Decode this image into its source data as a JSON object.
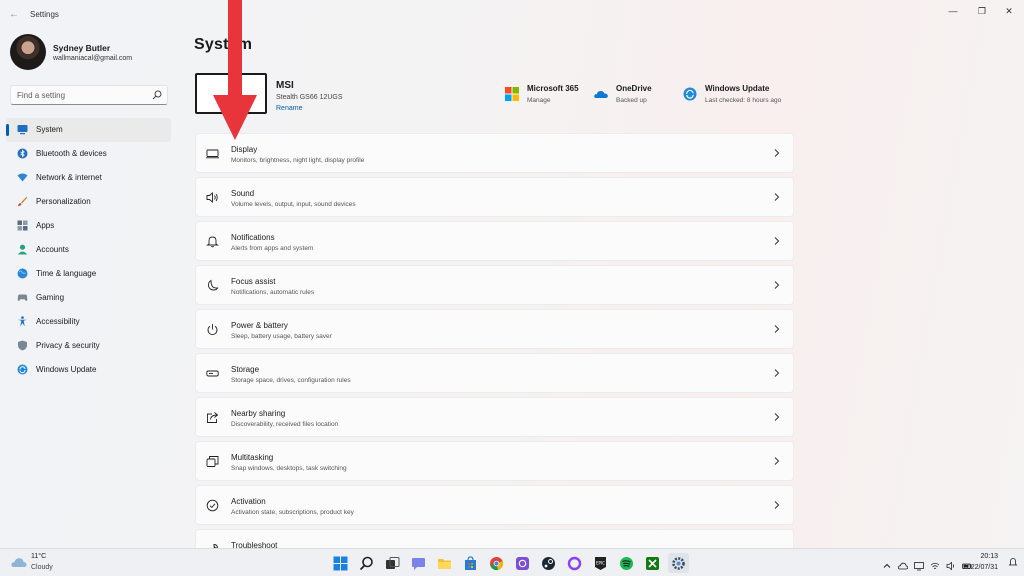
{
  "window": {
    "title": "Settings",
    "back_icon": "back-arrow-icon",
    "controls": [
      "minimize",
      "restore",
      "close"
    ]
  },
  "user": {
    "name": "Sydney Butler",
    "email": "wallmaniacal@gmail.com"
  },
  "search": {
    "placeholder": "Find a setting"
  },
  "sidebar": {
    "items": [
      {
        "label": "System",
        "icon": "system-icon",
        "active": true
      },
      {
        "label": "Bluetooth & devices",
        "icon": "bluetooth-icon"
      },
      {
        "label": "Network & internet",
        "icon": "wifi-icon"
      },
      {
        "label": "Personalization",
        "icon": "brush-icon"
      },
      {
        "label": "Apps",
        "icon": "apps-icon"
      },
      {
        "label": "Accounts",
        "icon": "person-icon"
      },
      {
        "label": "Time & language",
        "icon": "globe-icon"
      },
      {
        "label": "Gaming",
        "icon": "gamepad-icon"
      },
      {
        "label": "Accessibility",
        "icon": "accessibility-icon"
      },
      {
        "label": "Privacy & security",
        "icon": "shield-icon"
      },
      {
        "label": "Windows Update",
        "icon": "update-icon"
      }
    ]
  },
  "main": {
    "title": "System",
    "device": {
      "name": "MSI",
      "model": "Stealth GS66 12UGS",
      "rename": "Rename"
    },
    "quick": [
      {
        "title": "Microsoft 365",
        "subtitle": "Manage",
        "icon": "microsoft-logo-icon"
      },
      {
        "title": "OneDrive",
        "subtitle": "Backed up",
        "icon": "onedrive-cloud-icon"
      },
      {
        "title": "Windows Update",
        "subtitle": "Last checked: 8 hours ago",
        "icon": "update-icon"
      }
    ],
    "cards": [
      {
        "title": "Display",
        "subtitle": "Monitors, brightness, night light, display profile",
        "icon": "display-icon"
      },
      {
        "title": "Sound",
        "subtitle": "Volume levels, output, input, sound devices",
        "icon": "speaker-icon"
      },
      {
        "title": "Notifications",
        "subtitle": "Alerts from apps and system",
        "icon": "bell-icon"
      },
      {
        "title": "Focus assist",
        "subtitle": "Notifications, automatic rules",
        "icon": "moon-icon"
      },
      {
        "title": "Power & battery",
        "subtitle": "Sleep, battery usage, battery saver",
        "icon": "power-icon"
      },
      {
        "title": "Storage",
        "subtitle": "Storage space, drives, configuration rules",
        "icon": "storage-icon"
      },
      {
        "title": "Nearby sharing",
        "subtitle": "Discoverability, received files location",
        "icon": "share-icon"
      },
      {
        "title": "Multitasking",
        "subtitle": "Snap windows, desktops, task switching",
        "icon": "multitask-icon"
      },
      {
        "title": "Activation",
        "subtitle": "Activation state, subscriptions, product key",
        "icon": "check-circle-icon"
      },
      {
        "title": "Troubleshoot",
        "subtitle": "",
        "icon": "wrench-icon"
      }
    ]
  },
  "taskbar": {
    "weather": {
      "temp": "11°C",
      "condition": "Cloudy"
    },
    "clock": {
      "time": "20:13",
      "date": "2022/07/31"
    },
    "apps": [
      "windows-start-icon",
      "search-icon",
      "task-view-icon",
      "chat-icon",
      "file-explorer-icon",
      "store-icon",
      "chrome-icon",
      "app-icon",
      "steam-icon",
      "cortana-icon",
      "epic-games-icon",
      "spotify-icon",
      "xbox-icon",
      "settings-icon"
    ]
  },
  "colors": {
    "accent": "#005fb8",
    "annotation_arrow": "#e8343b"
  }
}
